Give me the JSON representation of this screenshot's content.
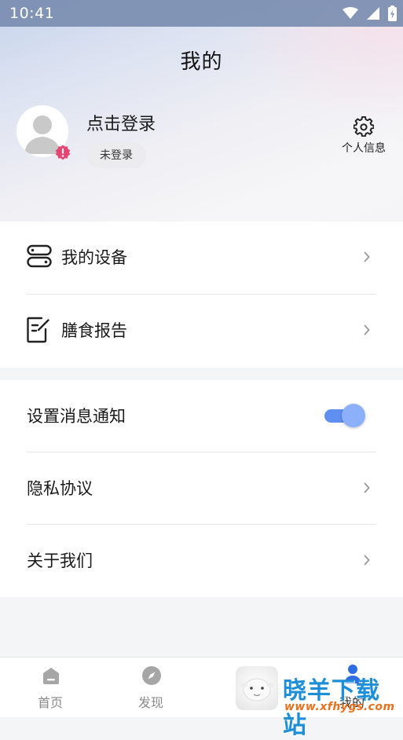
{
  "status_bar": {
    "time": "10:41"
  },
  "header": {
    "title": "我的"
  },
  "profile": {
    "login_prompt": "点击登录",
    "login_status": "未登录",
    "settings_label": "个人信息"
  },
  "menu_group_1": [
    {
      "label": "我的设备",
      "icon": "devices-icon"
    },
    {
      "label": "膳食报告",
      "icon": "report-icon"
    }
  ],
  "menu_group_2": {
    "notification": {
      "label": "设置消息通知",
      "enabled": true
    },
    "privacy": {
      "label": "隐私协议"
    },
    "about": {
      "label": "关于我们"
    }
  },
  "tabbar": {
    "home": {
      "label": "首页",
      "icon": "home-icon"
    },
    "discover": {
      "label": "发现",
      "icon": "compass-icon"
    },
    "mine": {
      "label": "我的",
      "icon": "profile-icon"
    }
  },
  "watermark": {
    "title": "晓羊下载站",
    "url": "www.xfhygs.com"
  },
  "colors": {
    "accent": "#5f8ff0",
    "badge": "#e64572",
    "watermark_blue": "#1e8fd6",
    "watermark_orange": "#e8711f"
  }
}
